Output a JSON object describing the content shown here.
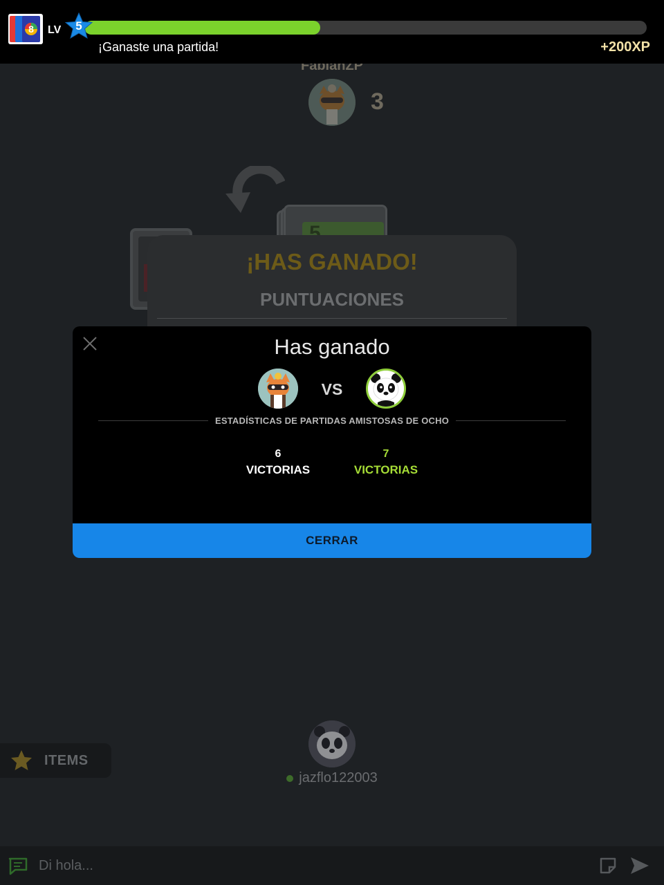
{
  "header": {
    "level_label": "LV",
    "level": "5",
    "xp_progress": 0.42,
    "message": "¡Ganaste una partida!",
    "xp_gain": "+200XP",
    "logo_card": "8",
    "colors": {
      "fill": "#7bd22c",
      "star": "#1a8ae6"
    }
  },
  "game": {
    "opponent": {
      "name": "FabianZP",
      "card_count": "3",
      "avatar_icon": "cat-avatar"
    },
    "discard_top_card": "5",
    "direction_icon": "reverse-arrow-icon",
    "result_panel": {
      "title": "¡HAS GANADO!",
      "subtitle": "PUNTUACIONES"
    },
    "player": {
      "name": "jazflo122003",
      "avatar_icon": "panda-avatar",
      "online": true
    },
    "items_label": "ITEMS"
  },
  "modal": {
    "title": "Has ganado",
    "vs_label": "VS",
    "stats_heading": "ESTADÍSTICAS DE PARTIDAS AMISTOSAS DE OCHO",
    "left": {
      "wins": "6",
      "label": "VICTORIAS"
    },
    "right": {
      "wins": "7",
      "label": "VICTORIAS"
    },
    "close_button": "CERRAR"
  },
  "chat": {
    "placeholder": "Di hola..."
  }
}
